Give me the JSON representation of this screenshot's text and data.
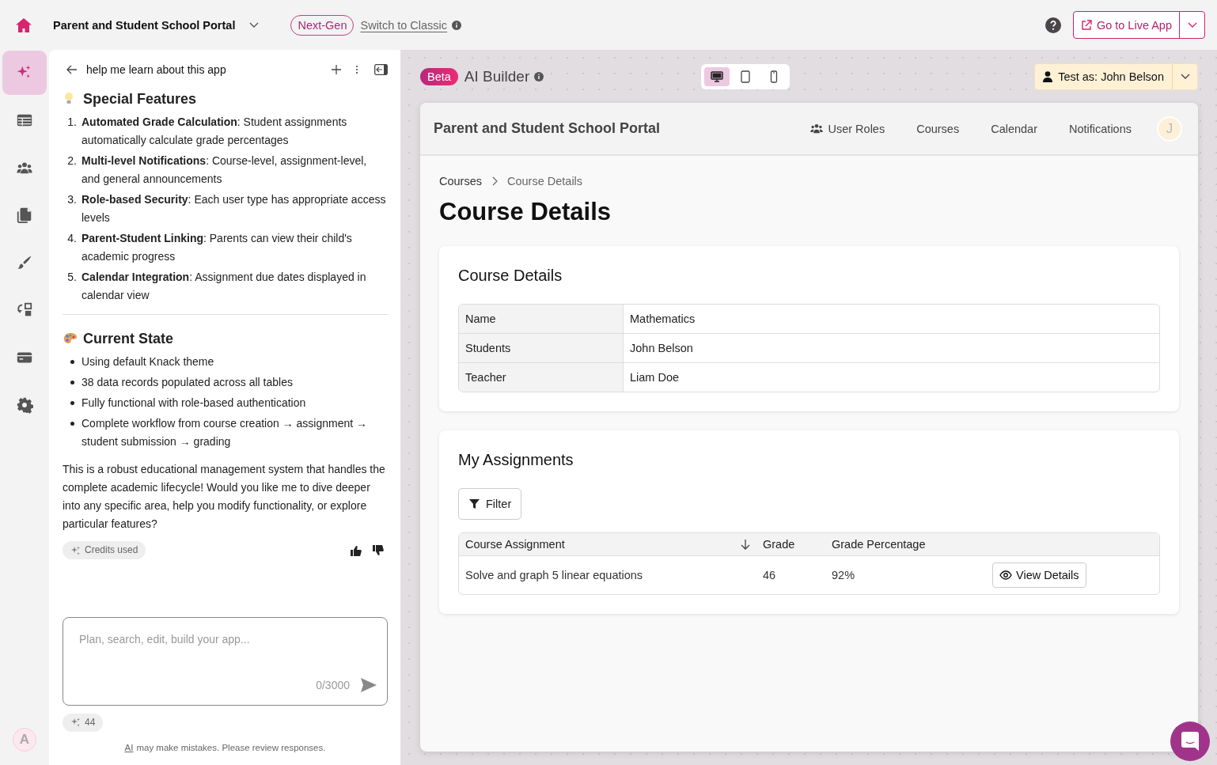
{
  "topbar": {
    "app_name": "Parent and Student School Portal",
    "badge": "Next-Gen",
    "switch_link": "Switch to Classic",
    "live_button": "Go to Live App"
  },
  "rail": {
    "items": [
      {
        "kind": "sparkle",
        "selected": true
      },
      {
        "kind": "table",
        "selected": false
      },
      {
        "kind": "users",
        "selected": false
      },
      {
        "kind": "pages",
        "selected": false
      },
      {
        "kind": "brush",
        "selected": false
      },
      {
        "kind": "flows",
        "selected": false
      },
      {
        "kind": "card",
        "selected": false
      },
      {
        "kind": "gear",
        "selected": false
      }
    ],
    "avatar": "A"
  },
  "chat": {
    "title": "help me learn about this app",
    "blocks": [
      {
        "kind": "heading",
        "text": "Special Features"
      },
      {
        "kind": "numbered",
        "items": [
          {
            "marker": "1.",
            "text": "**Automated Grade Calculation**: Student assignments automatically calculate grade percentages"
          },
          {
            "marker": "2.",
            "text": "**Multi-level Notifications**: Course-level, assignment-level, and general announcements"
          },
          {
            "marker": "3.",
            "text": "**Role-based Security**: Each user type has appropriate access levels"
          },
          {
            "marker": "4.",
            "text": "**Parent-Student Linking**: Parents can view their child's academic progress"
          },
          {
            "marker": "5.",
            "text": "**Calendar Integration**: Assignment due dates displayed in calendar view"
          }
        ]
      },
      {
        "kind": "divider"
      },
      {
        "kind": "heading",
        "text": "Current State"
      },
      {
        "kind": "bullets",
        "items": [
          "Using default Knack theme",
          "38 data records populated across all tables",
          "Fully functional with role-based authentication",
          "Complete workflow from course creation → assignment → student submission → grading"
        ]
      },
      {
        "kind": "paragraph",
        "text": "This is a robust educational management system that handles the complete academic lifecycle! Would you like me to dive deeper into any specific area, help you modify functionality, or explore particular features?"
      }
    ],
    "credits_chip": "Credits used",
    "input": {
      "placeholder": "Plan, search, edit, build your app...",
      "counter": "0/3000"
    },
    "credits_count": "44",
    "disclaimer": {
      "link": "AI",
      "text": "may make mistakes. Please review responses."
    }
  },
  "builder": {
    "badge": "Beta",
    "title": "AI Builder",
    "devices": [
      {
        "kind": "desktop",
        "selected": true
      },
      {
        "kind": "tablet",
        "selected": false
      },
      {
        "kind": "phone",
        "selected": false
      }
    ],
    "test_as": "Test as: John Belson",
    "preview": {
      "app_title": "Parent and Student School Portal",
      "nav": [
        {
          "label": "User Roles"
        },
        {
          "label": "Courses"
        },
        {
          "label": "Calendar"
        },
        {
          "label": "Notifications"
        }
      ],
      "avatar": "J",
      "breadcrumb": [
        "Courses",
        "Course Details"
      ],
      "page_title": "Course Details",
      "details": {
        "title": "Course Details",
        "rows": [
          {
            "label": "Name",
            "value": "Mathematics"
          },
          {
            "label": "Students",
            "value": "John Belson"
          },
          {
            "label": "Teacher",
            "value": "Liam Doe"
          }
        ]
      },
      "assignments": {
        "title": "My Assignments",
        "filter": "Filter",
        "columns": [
          {
            "label": "Course Assignment",
            "sorted": true
          },
          {
            "label": "Grade",
            "sorted": false
          },
          {
            "label": "Grade Percentage",
            "sorted": false
          }
        ],
        "rows": [
          {
            "cells": [
              "Solve and graph 5 linear equations",
              "46",
              "92%"
            ],
            "action": "View Details"
          }
        ]
      }
    }
  }
}
